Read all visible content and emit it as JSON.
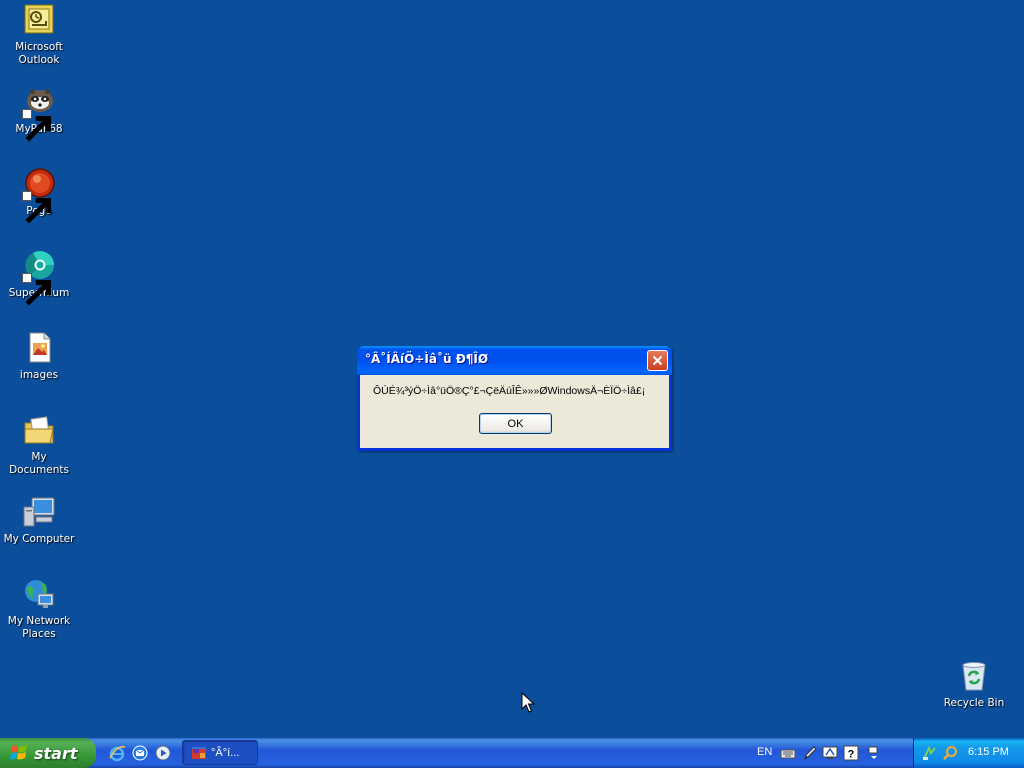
{
  "desktop_icons": [
    {
      "label": "Microsoft Outlook",
      "icon": "outlook-icon"
    },
    {
      "label": "MyPal 68",
      "icon": "mypal-icon"
    },
    {
      "label": "Pego",
      "icon": "pego-icon"
    },
    {
      "label": "Supermium",
      "icon": "supermium-icon"
    },
    {
      "label": "images",
      "icon": "image-file-icon"
    },
    {
      "label": "My Documents",
      "icon": "my-documents-icon"
    },
    {
      "label": "My Computer",
      "icon": "my-computer-icon"
    },
    {
      "label": "My Network Places",
      "icon": "network-places-icon"
    },
    {
      "label": "Recycle Bin",
      "icon": "recycle-bin-icon"
    }
  ],
  "dialog": {
    "title": "°Â˚ÍÂíÖ÷Ìâ˚ü  Ð¶ÎØ",
    "message": "ÔÚÉ¾³ýÖ÷Ìâ°üÖ®Ç°£¬ÇëÄúÎÊ»»»ØWindowsÄ¬ÈÏÖ÷Ìâ£¡",
    "ok_label": "OK"
  },
  "taskbar": {
    "start_label": "start",
    "task_button_label": "°Â°í...",
    "language": "EN",
    "clock": "6:15 PM"
  },
  "colors": {
    "desktop": "#0b4e9c",
    "titlebar": "#0053ee",
    "dialog_body": "#ece9d8",
    "start_button": "#379837"
  }
}
